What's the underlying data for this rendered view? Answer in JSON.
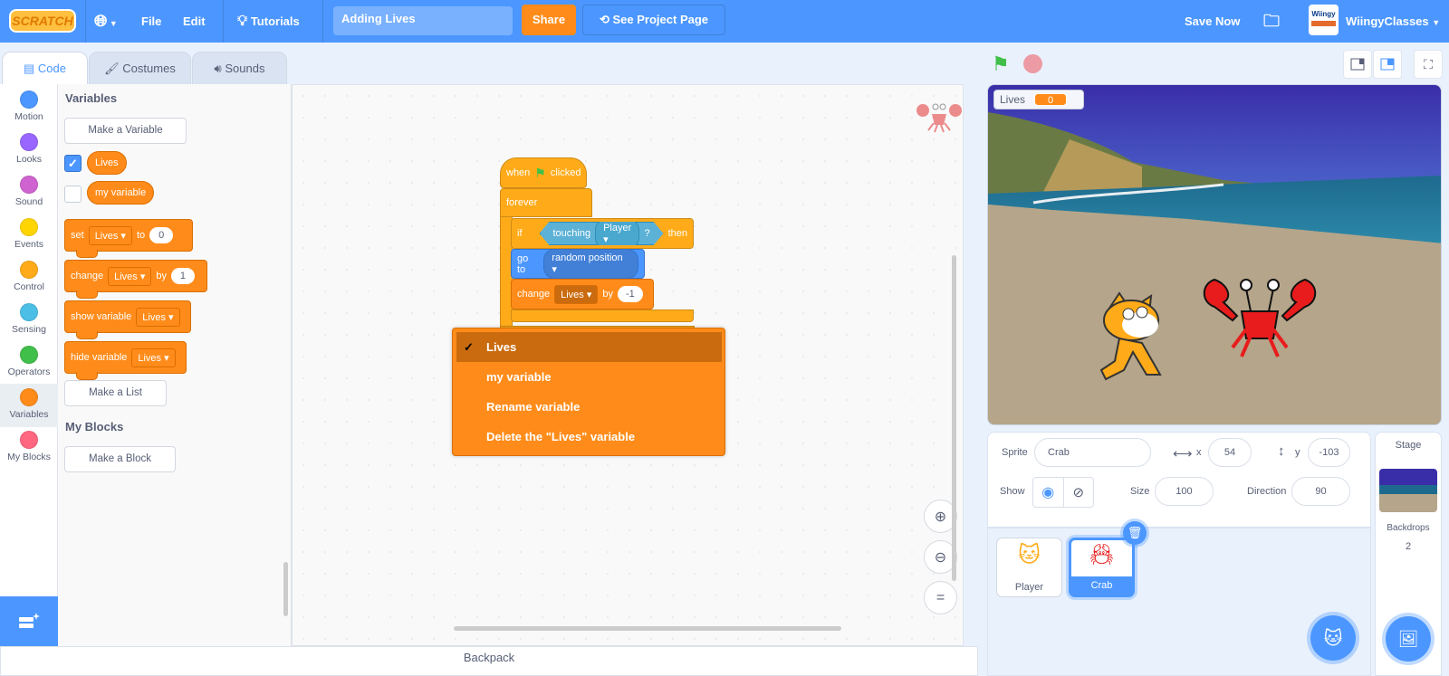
{
  "menubar": {
    "logo_text": "SCRATCH",
    "file": "File",
    "edit": "Edit",
    "tutorials": "Tutorials",
    "project_title": "Adding Lives",
    "share": "Share",
    "see_project_page": "See Project Page",
    "save_now": "Save Now",
    "username": "WiingyClasses",
    "avatar_text": "Wiingy"
  },
  "tabs": [
    {
      "label": "Code",
      "active": true
    },
    {
      "label": "Costumes",
      "active": false
    },
    {
      "label": "Sounds",
      "active": false
    }
  ],
  "categories": [
    {
      "label": "Motion",
      "color": "#4c97ff"
    },
    {
      "label": "Looks",
      "color": "#9966ff"
    },
    {
      "label": "Sound",
      "color": "#cf63cf"
    },
    {
      "label": "Events",
      "color": "#ffd500"
    },
    {
      "label": "Control",
      "color": "#ffab19"
    },
    {
      "label": "Sensing",
      "color": "#4cbfe6"
    },
    {
      "label": "Operators",
      "color": "#40bf4a"
    },
    {
      "label": "Variables",
      "color": "#ff8c1a"
    },
    {
      "label": "My Blocks",
      "color": "#ff6680"
    }
  ],
  "palette": {
    "variables_heading": "Variables",
    "make_variable": "Make a Variable",
    "variables": [
      {
        "name": "Lives",
        "checked": true
      },
      {
        "name": "my variable",
        "checked": false
      }
    ],
    "set_block": {
      "label": "set",
      "var": "Lives",
      "to": "to",
      "value": "0"
    },
    "change_block": {
      "label": "change",
      "var": "Lives",
      "by": "by",
      "value": "1"
    },
    "show_block": {
      "label": "show variable",
      "var": "Lives"
    },
    "hide_block": {
      "label": "hide variable",
      "var": "Lives"
    },
    "make_list": "Make a List",
    "myblocks_heading": "My Blocks",
    "make_block": "Make a Block"
  },
  "script": {
    "when": "when",
    "clicked": "clicked",
    "forever": "forever",
    "if": "if",
    "touching": "touching",
    "touching_target": "Player",
    "question": "?",
    "then": "then",
    "goto": "go to",
    "goto_target": "random position",
    "change": "change",
    "change_var": "Lives",
    "by": "by",
    "change_value": "-1"
  },
  "dropdown_menu": {
    "items": [
      {
        "label": "Lives",
        "selected": true
      },
      {
        "label": "my variable",
        "selected": false
      },
      {
        "label": "Rename variable",
        "selected": false
      },
      {
        "label": "Delete the \"Lives\" variable",
        "selected": false
      }
    ],
    "check_glyph": "✓"
  },
  "backpack": "Backpack",
  "stage": {
    "monitor_label": "Lives",
    "monitor_value": "0"
  },
  "sprite_info": {
    "sprite_label": "Sprite",
    "sprite_name": "Crab",
    "x_label": "x",
    "x": "54",
    "y_label": "y",
    "y": "-103",
    "show_label": "Show",
    "size_label": "Size",
    "size": "100",
    "direction_label": "Direction",
    "direction": "90"
  },
  "sprites": [
    {
      "name": "Player",
      "selected": false
    },
    {
      "name": "Crab",
      "selected": true
    }
  ],
  "stage_panel": {
    "title": "Stage",
    "backdrops_label": "Backdrops",
    "backdrops_count": "2"
  },
  "colors": {
    "brand_blue": "#4c97ff",
    "variables_orange": "#ff8c1a",
    "control_orange": "#ffab19",
    "share_orange": "#ff8c1a"
  }
}
